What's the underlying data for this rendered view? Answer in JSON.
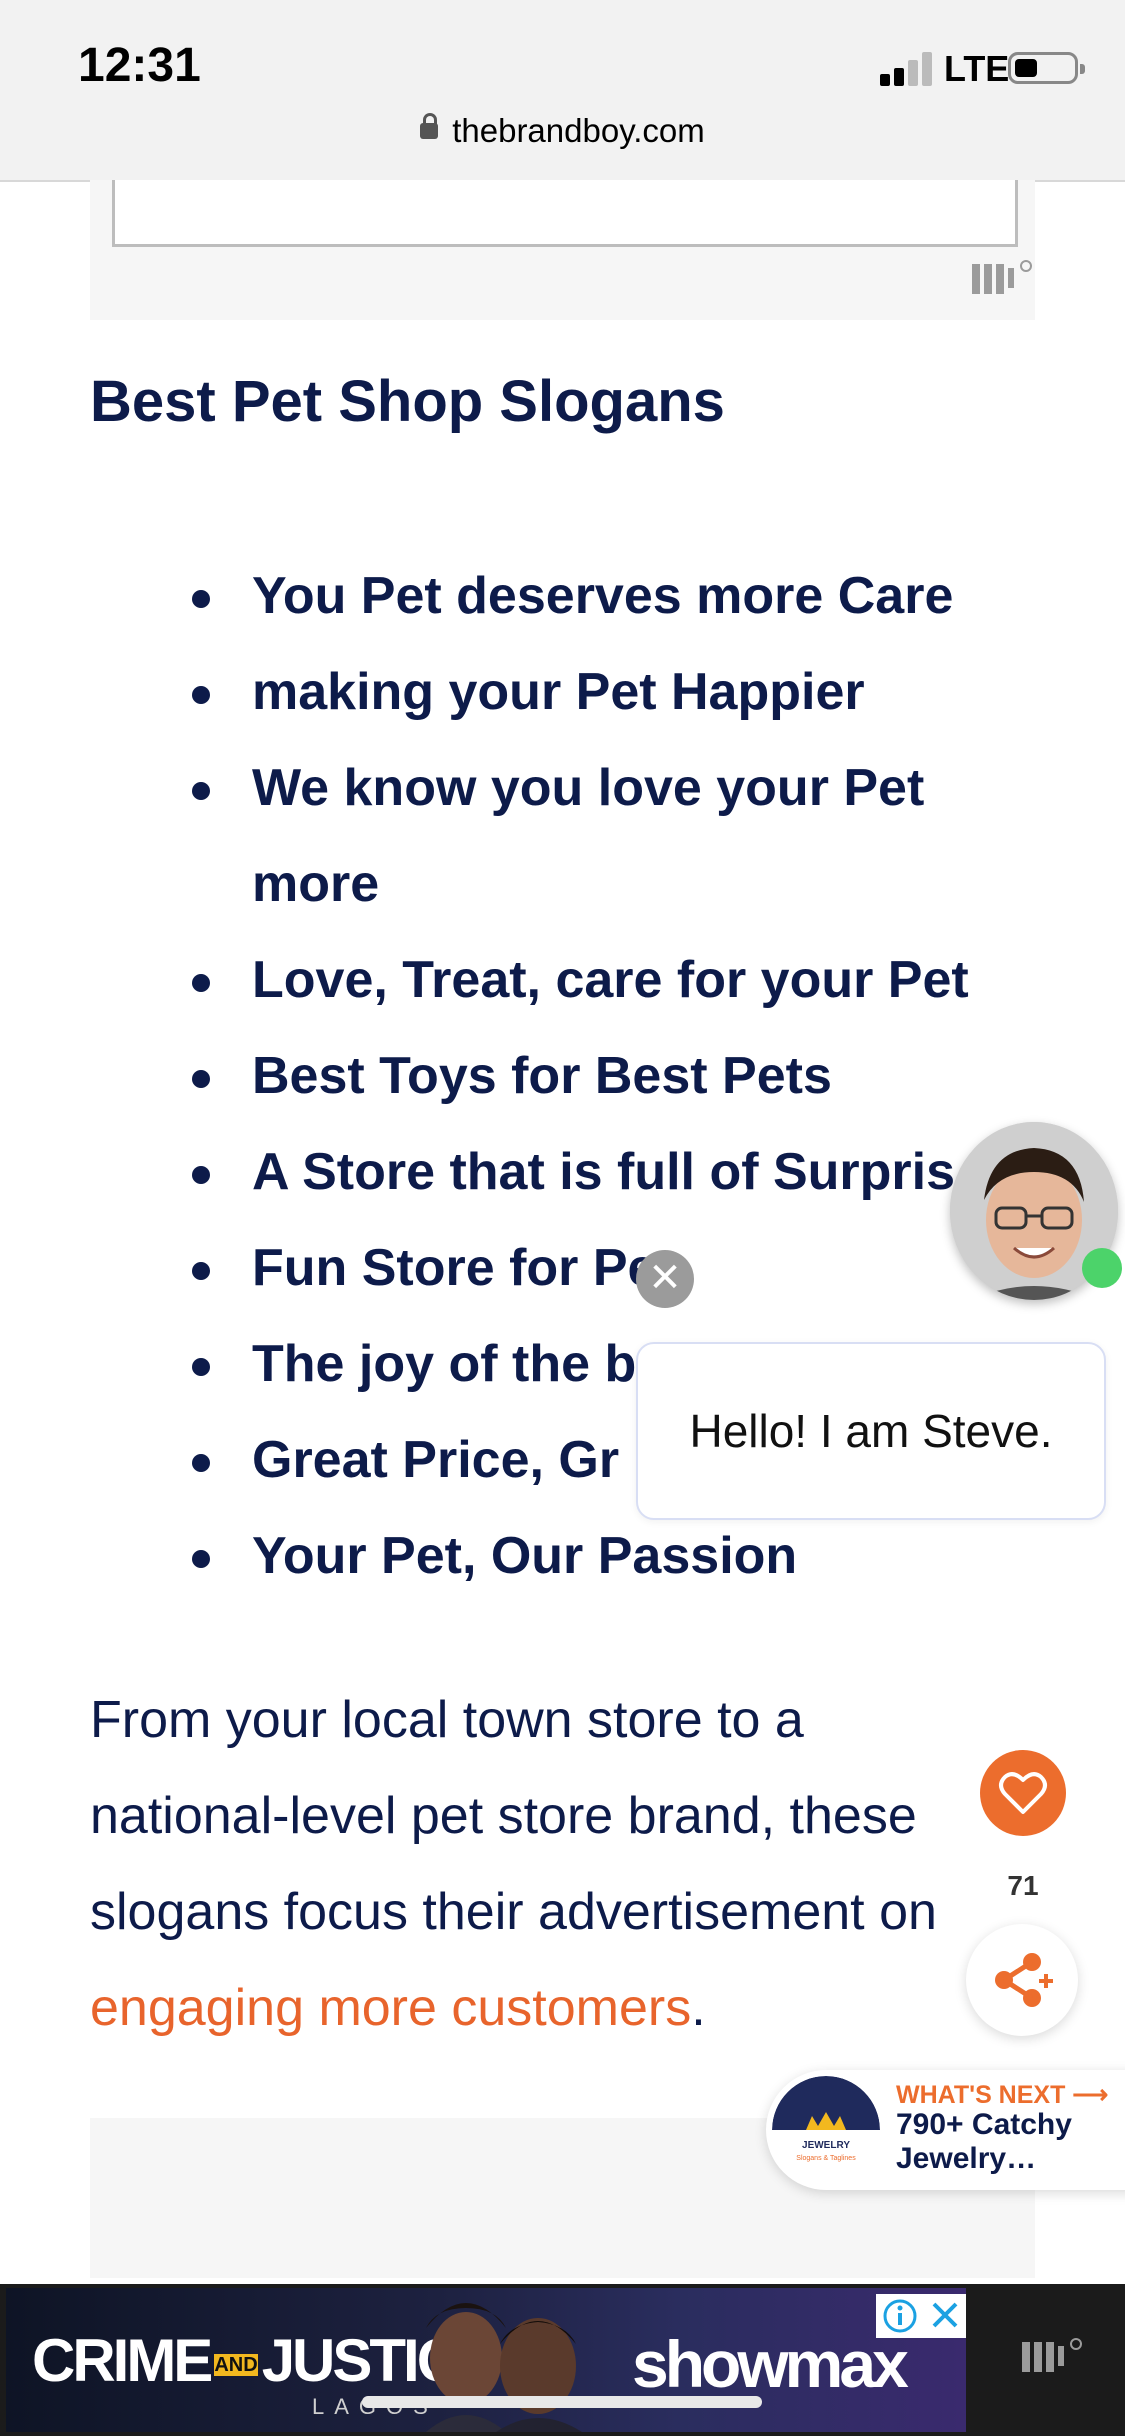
{
  "status_bar": {
    "time": "12:31",
    "network": "LTE"
  },
  "browser": {
    "url": "thebrandboy.com"
  },
  "article": {
    "heading": "Best Pet Shop Slogans",
    "slogans": [
      "You Pet deserves more Care",
      "making your Pet Happier",
      "We know you love your Pet more",
      "Love, Treat, care for your Pet",
      "Best Toys for Best Pets",
      "A Store that is full of Surpris",
      "Fun Store for Pet",
      "The joy of the best Things",
      "Great Price, Gr",
      "Your Pet, Our Passion"
    ],
    "paragraph_text": "From your local town store to a national-level pet store brand, these slogans focus their advertisement on ",
    "paragraph_link": "engaging more customers",
    "paragraph_end": "."
  },
  "chat_widget": {
    "close_symbol": "✕",
    "greeting": "Hello! I am Steve."
  },
  "social": {
    "like_count": "71"
  },
  "whats_next": {
    "label": "WHAT'S NEXT",
    "title": "790+ Catchy Jewelry…",
    "thumb_text": "JEWELRY",
    "thumb_sub": "Slogans & Taglines"
  },
  "bottom_ad": {
    "title": "CRIME",
    "title_mid": "AND",
    "title_end": "JUSTICE",
    "subtitle": "LAGOS",
    "brand": "showmax"
  },
  "colors": {
    "text": "#0d1b4a",
    "accent": "#e8642c",
    "online": "#4cd36a"
  }
}
